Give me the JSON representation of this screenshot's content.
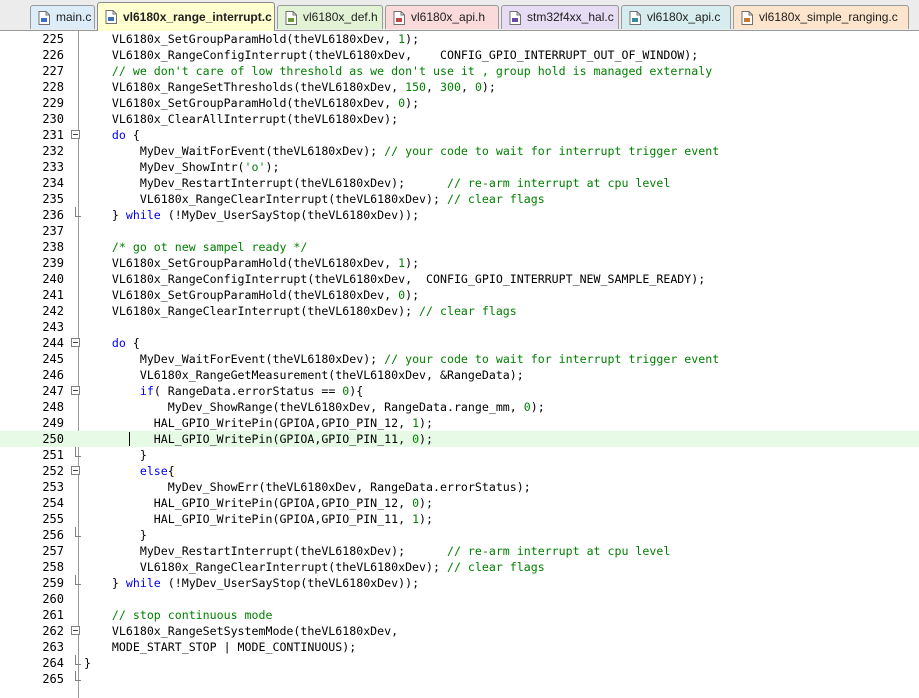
{
  "tabs": [
    {
      "label": "main.c",
      "color": "#dcecf8",
      "icon_color": "#3b6fc4",
      "active": false
    },
    {
      "label": "vl6180x_range_interrupt.c",
      "color": "#ffffd0",
      "icon_color": "#3b6fc4",
      "active": true
    },
    {
      "label": "vl6180x_def.h",
      "color": "#e2f2d4",
      "icon_color": "#6a9a3a",
      "active": false
    },
    {
      "label": "vl6180x_api.h",
      "color": "#fadada",
      "icon_color": "#c04848",
      "active": false
    },
    {
      "label": "stm32f4xx_hal.c",
      "color": "#e6dcf4",
      "icon_color": "#6a4aa8",
      "active": false
    },
    {
      "label": "vl6180x_api.c",
      "color": "#d6ecee",
      "icon_color": "#3a8a9a",
      "active": false
    },
    {
      "label": "vl6180x_simple_ranging.c",
      "color": "#fde4cc",
      "icon_color": "#c87a30",
      "active": false
    }
  ],
  "editor": {
    "current_line": "250",
    "lines": [
      {
        "n": "225",
        "fold": "",
        "tokens": [
          {
            "t": "    VL6180x_SetGroupParamHold(theVL6180xDev, ",
            "c": ""
          },
          {
            "t": "1",
            "c": "number"
          },
          {
            "t": ");",
            "c": ""
          }
        ]
      },
      {
        "n": "226",
        "fold": "",
        "tokens": [
          {
            "t": "    VL6180x_RangeConfigInterrupt(theVL6180xDev,    CONFIG_GPIO_INTERRUPT_OUT_OF_WINDOW);",
            "c": ""
          }
        ]
      },
      {
        "n": "227",
        "fold": "",
        "tokens": [
          {
            "t": "    // we don't care of low threshold as we don't use it , group hold is managed externaly",
            "c": "comment"
          }
        ]
      },
      {
        "n": "228",
        "fold": "",
        "tokens": [
          {
            "t": "    VL6180x_RangeSetThresholds(theVL6180xDev, ",
            "c": ""
          },
          {
            "t": "150",
            "c": "number"
          },
          {
            "t": ", ",
            "c": ""
          },
          {
            "t": "300",
            "c": "number"
          },
          {
            "t": ", ",
            "c": ""
          },
          {
            "t": "0",
            "c": "number"
          },
          {
            "t": ");",
            "c": ""
          }
        ]
      },
      {
        "n": "229",
        "fold": "",
        "tokens": [
          {
            "t": "    VL6180x_SetGroupParamHold(theVL6180xDev, ",
            "c": ""
          },
          {
            "t": "0",
            "c": "number"
          },
          {
            "t": ");",
            "c": ""
          }
        ]
      },
      {
        "n": "230",
        "fold": "",
        "tokens": [
          {
            "t": "    VL6180x_ClearAllInterrupt(theVL6180xDev);",
            "c": ""
          }
        ]
      },
      {
        "n": "231",
        "fold": "open",
        "tokens": [
          {
            "t": "    ",
            "c": ""
          },
          {
            "t": "do",
            "c": "keyword"
          },
          {
            "t": " {",
            "c": ""
          }
        ]
      },
      {
        "n": "232",
        "fold": "",
        "tokens": [
          {
            "t": "        MyDev_WaitForEvent(theVL6180xDev); ",
            "c": ""
          },
          {
            "t": "// your code to wait for interrupt trigger event",
            "c": "comment"
          }
        ]
      },
      {
        "n": "233",
        "fold": "",
        "tokens": [
          {
            "t": "        MyDev_ShowIntr(",
            "c": ""
          },
          {
            "t": "'o'",
            "c": "number"
          },
          {
            "t": ");",
            "c": ""
          }
        ]
      },
      {
        "n": "234",
        "fold": "",
        "tokens": [
          {
            "t": "        MyDev_RestartInterrupt(theVL6180xDev);      ",
            "c": ""
          },
          {
            "t": "// re-arm interrupt at cpu level",
            "c": "comment"
          }
        ]
      },
      {
        "n": "235",
        "fold": "",
        "tokens": [
          {
            "t": "        VL6180x_RangeClearInterrupt(theVL6180xDev); ",
            "c": ""
          },
          {
            "t": "// clear flags",
            "c": "comment"
          }
        ]
      },
      {
        "n": "236",
        "fold": "end",
        "tokens": [
          {
            "t": "    } ",
            "c": ""
          },
          {
            "t": "while",
            "c": "keyword"
          },
          {
            "t": " (!MyDev_UserSayStop(theVL6180xDev));",
            "c": ""
          }
        ]
      },
      {
        "n": "237",
        "fold": "",
        "tokens": []
      },
      {
        "n": "238",
        "fold": "",
        "tokens": [
          {
            "t": "    /* go ot new sampel ready */",
            "c": "comment"
          }
        ]
      },
      {
        "n": "239",
        "fold": "",
        "tokens": [
          {
            "t": "    VL6180x_SetGroupParamHold(theVL6180xDev, ",
            "c": ""
          },
          {
            "t": "1",
            "c": "number"
          },
          {
            "t": ");",
            "c": ""
          }
        ]
      },
      {
        "n": "240",
        "fold": "",
        "tokens": [
          {
            "t": "    VL6180x_RangeConfigInterrupt(theVL6180xDev,  CONFIG_GPIO_INTERRUPT_NEW_SAMPLE_READY);",
            "c": ""
          }
        ]
      },
      {
        "n": "241",
        "fold": "",
        "tokens": [
          {
            "t": "    VL6180x_SetGroupParamHold(theVL6180xDev, ",
            "c": ""
          },
          {
            "t": "0",
            "c": "number"
          },
          {
            "t": ");",
            "c": ""
          }
        ]
      },
      {
        "n": "242",
        "fold": "",
        "tokens": [
          {
            "t": "    VL6180x_RangeClearInterrupt(theVL6180xDev); ",
            "c": ""
          },
          {
            "t": "// clear flags",
            "c": "comment"
          }
        ]
      },
      {
        "n": "243",
        "fold": "",
        "tokens": []
      },
      {
        "n": "244",
        "fold": "open",
        "tokens": [
          {
            "t": "    ",
            "c": ""
          },
          {
            "t": "do",
            "c": "keyword"
          },
          {
            "t": " {",
            "c": ""
          }
        ]
      },
      {
        "n": "245",
        "fold": "",
        "tokens": [
          {
            "t": "        MyDev_WaitForEvent(theVL6180xDev); ",
            "c": ""
          },
          {
            "t": "// your code to wait for interrupt trigger event",
            "c": "comment"
          }
        ]
      },
      {
        "n": "246",
        "fold": "",
        "tokens": [
          {
            "t": "        VL6180x_RangeGetMeasurement(theVL6180xDev, &RangeData);",
            "c": ""
          }
        ]
      },
      {
        "n": "247",
        "fold": "open",
        "tokens": [
          {
            "t": "        ",
            "c": ""
          },
          {
            "t": "if",
            "c": "keyword"
          },
          {
            "t": "( RangeData.errorStatus == ",
            "c": ""
          },
          {
            "t": "0",
            "c": "number"
          },
          {
            "t": "){",
            "c": ""
          }
        ]
      },
      {
        "n": "248",
        "fold": "",
        "tokens": [
          {
            "t": "            MyDev_ShowRange(theVL6180xDev, RangeData.range_mm, ",
            "c": ""
          },
          {
            "t": "0",
            "c": "number"
          },
          {
            "t": ");",
            "c": ""
          }
        ]
      },
      {
        "n": "249",
        "fold": "",
        "tokens": [
          {
            "t": "          HAL_GPIO_WritePin(GPIOA,GPIO_PIN_12, ",
            "c": ""
          },
          {
            "t": "1",
            "c": "number"
          },
          {
            "t": ");",
            "c": ""
          }
        ]
      },
      {
        "n": "250",
        "fold": "",
        "tokens": [
          {
            "t": "          HAL_GPIO_WritePin(GPIOA,GPIO_PIN_11, ",
            "c": ""
          },
          {
            "t": "0",
            "c": "number"
          },
          {
            "t": ");",
            "c": ""
          }
        ]
      },
      {
        "n": "251",
        "fold": "end",
        "tokens": [
          {
            "t": "        }",
            "c": ""
          }
        ]
      },
      {
        "n": "252",
        "fold": "open",
        "tokens": [
          {
            "t": "        ",
            "c": ""
          },
          {
            "t": "else",
            "c": "keyword"
          },
          {
            "t": "{",
            "c": ""
          }
        ]
      },
      {
        "n": "253",
        "fold": "",
        "tokens": [
          {
            "t": "            MyDev_ShowErr(theVL6180xDev, RangeData.errorStatus);",
            "c": ""
          }
        ]
      },
      {
        "n": "254",
        "fold": "",
        "tokens": [
          {
            "t": "          HAL_GPIO_WritePin(GPIOA,GPIO_PIN_12, ",
            "c": ""
          },
          {
            "t": "0",
            "c": "number"
          },
          {
            "t": ");",
            "c": ""
          }
        ]
      },
      {
        "n": "255",
        "fold": "",
        "tokens": [
          {
            "t": "          HAL_GPIO_WritePin(GPIOA,GPIO_PIN_11, ",
            "c": ""
          },
          {
            "t": "1",
            "c": "number"
          },
          {
            "t": ");",
            "c": ""
          }
        ]
      },
      {
        "n": "256",
        "fold": "end",
        "tokens": [
          {
            "t": "        }",
            "c": ""
          }
        ]
      },
      {
        "n": "257",
        "fold": "",
        "tokens": [
          {
            "t": "        MyDev_RestartInterrupt(theVL6180xDev);      ",
            "c": ""
          },
          {
            "t": "// re-arm interrupt at cpu level",
            "c": "comment"
          }
        ]
      },
      {
        "n": "258",
        "fold": "",
        "tokens": [
          {
            "t": "        VL6180x_RangeClearInterrupt(theVL6180xDev); ",
            "c": ""
          },
          {
            "t": "// clear flags",
            "c": "comment"
          }
        ]
      },
      {
        "n": "259",
        "fold": "end",
        "tokens": [
          {
            "t": "    } ",
            "c": ""
          },
          {
            "t": "while",
            "c": "keyword"
          },
          {
            "t": " (!MyDev_UserSayStop(theVL6180xDev));",
            "c": ""
          }
        ]
      },
      {
        "n": "260",
        "fold": "",
        "tokens": []
      },
      {
        "n": "261",
        "fold": "",
        "tokens": [
          {
            "t": "    // stop continuous mode",
            "c": "comment"
          }
        ]
      },
      {
        "n": "262",
        "fold": "open",
        "tokens": [
          {
            "t": "    VL6180x_RangeSetSystemMode(theVL6180xDev,",
            "c": ""
          }
        ]
      },
      {
        "n": "263",
        "fold": "",
        "tokens": [
          {
            "t": "    MODE_START_STOP | MODE_CONTINUOUS);",
            "c": ""
          }
        ]
      },
      {
        "n": "264",
        "fold": "end",
        "tokens": [
          {
            "t": "}",
            "c": ""
          }
        ]
      },
      {
        "n": "265",
        "fold": "end",
        "tokens": []
      }
    ]
  }
}
